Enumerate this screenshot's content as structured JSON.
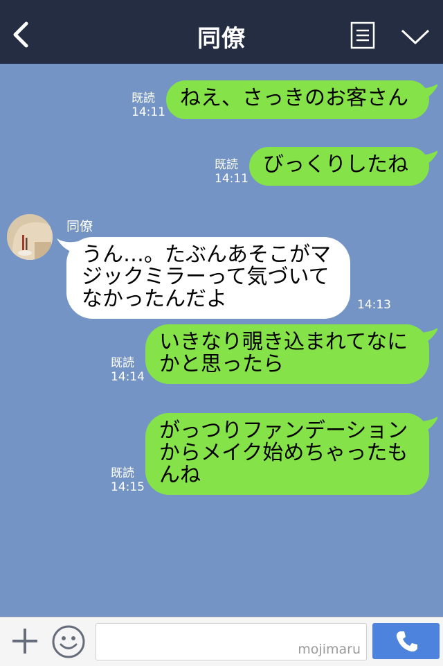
{
  "header": {
    "title": "同僚",
    "back_icon": "chevron-left-icon",
    "notes_icon": "notes-icon",
    "menu_icon": "chevron-down-icon"
  },
  "messages": [
    {
      "side": "me",
      "text": "ねえ、さっきのお客さん",
      "read": "既読",
      "time": "14:11"
    },
    {
      "side": "me",
      "text": "びっくりしたね",
      "read": "既読",
      "time": "14:11"
    },
    {
      "side": "them",
      "sender": "同僚",
      "text": "うん…。たぶんあそこがマ\nジックミラーって気づいて\nなかったんだよ",
      "time": "14:13"
    },
    {
      "side": "me",
      "text": "いきなり覗き込まれてなに\nかと思ったら",
      "read": "既読",
      "time": "14:14"
    },
    {
      "side": "me",
      "text": "がっつりファンデーション\nからメイク始めちゃったも\nんね",
      "read": "既読",
      "time": "14:15"
    }
  ],
  "footer": {
    "plus_icon": "plus-icon",
    "emoji_icon": "smiley-icon",
    "input_value": "",
    "watermark": "mojimaru",
    "call_icon": "phone-icon"
  },
  "colors": {
    "header_bg": "#252d43",
    "chat_bg": "#7394c4",
    "my_bubble": "#85e249",
    "their_bubble": "#ffffff",
    "call_button": "#4d83dc"
  }
}
